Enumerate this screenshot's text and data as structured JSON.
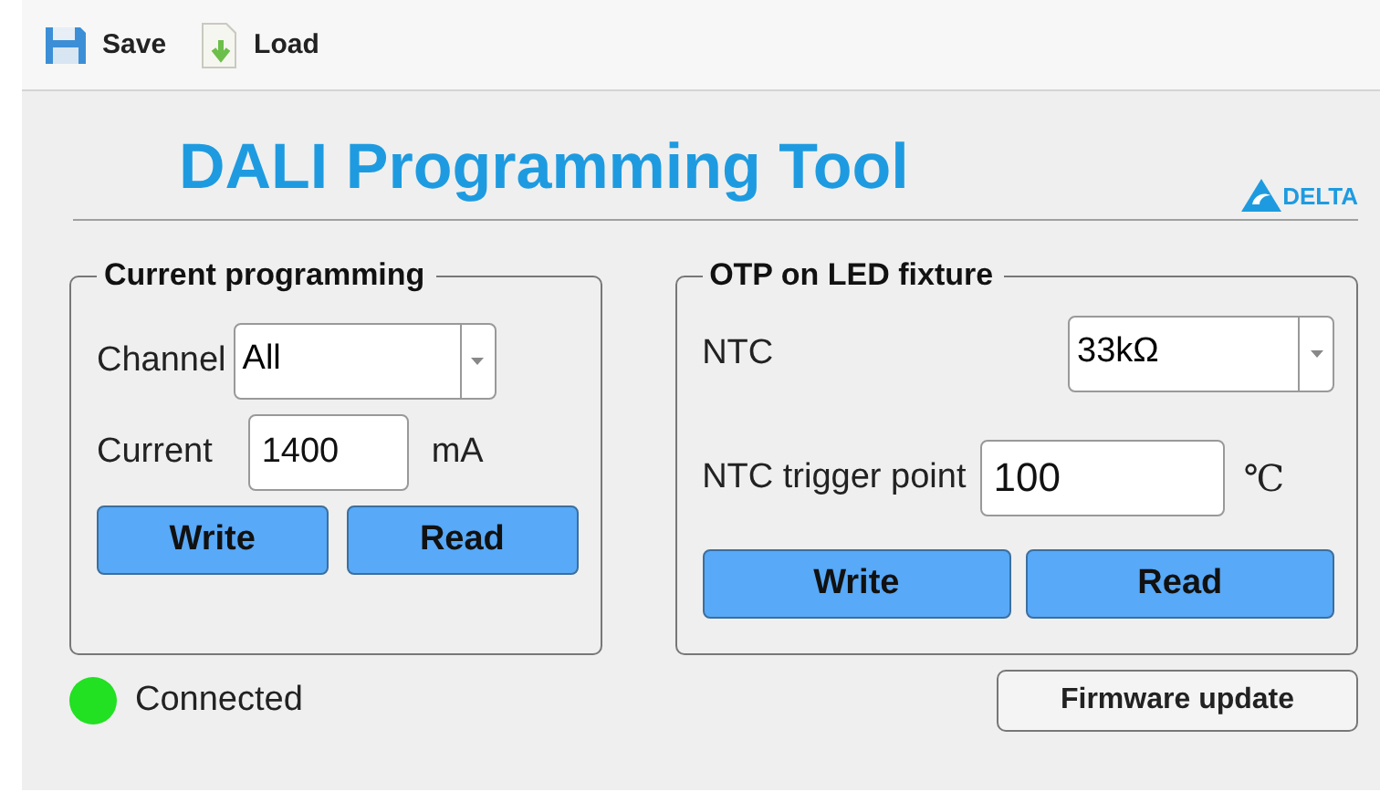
{
  "toolbar": [
    {
      "label": "Save"
    },
    {
      "label": "Load"
    }
  ],
  "title": "DALI Programming Tool",
  "logo": "DELTA",
  "current_programming": {
    "title": "Current programming",
    "channel_label": "Channel",
    "channel_value": "All",
    "current_label": "Current",
    "current_value": "1400",
    "current_unit": "mA",
    "buttons": [
      "Write",
      "Read"
    ]
  },
  "otp": {
    "title": "OTP on LED fixture",
    "ntc_label": "NTC",
    "ntc_value": "33kΩ",
    "trigger_label": "NTC trigger point",
    "trigger_value": "100",
    "trigger_unit": "℃",
    "buttons": [
      "Write",
      "Read"
    ]
  },
  "status": {
    "label": "Connected",
    "connected": true
  },
  "firmware_button": "Firmware update"
}
